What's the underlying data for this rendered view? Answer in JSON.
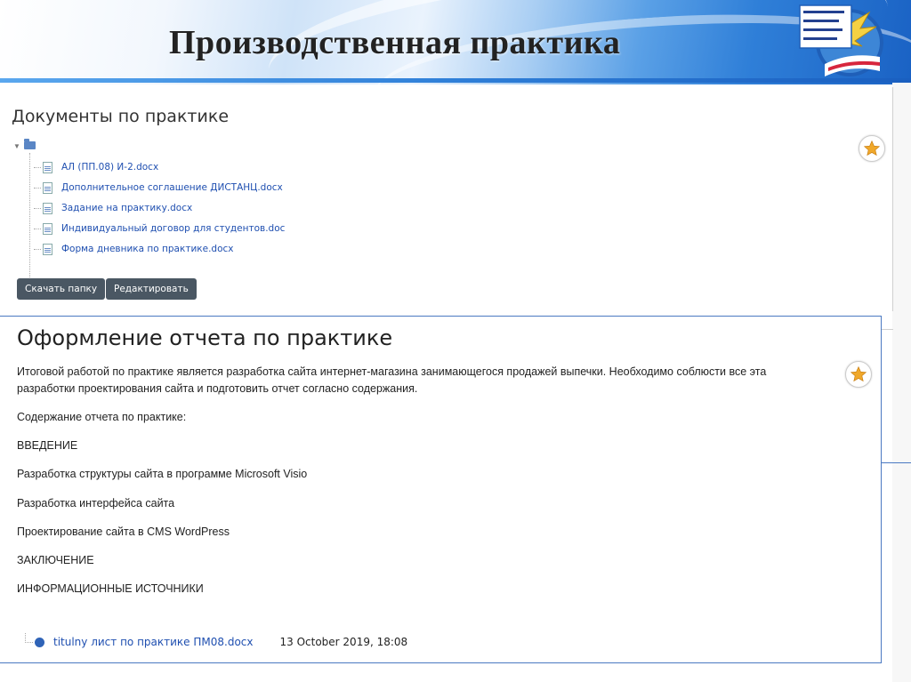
{
  "slide": {
    "title": "Производственная практика"
  },
  "documents": {
    "heading": "Документы по практике",
    "files": [
      "АЛ (ПП.08) И-2.docx",
      "Дополнительное соглашение ДИСТАНЦ.docx",
      "Задание на практику.docx",
      "Индивидуальный договор для студентов.doc",
      "Форма дневника по практике.docx"
    ],
    "download_label": "Скачать папку",
    "edit_label": "Редактировать"
  },
  "report": {
    "heading": "Оформление отчета по практике",
    "intro_line1": "Итоговой работой по практике является разработка сайта интернет-магазина занимающегося продажей выпечки. Необходимо соблюсти все эта",
    "intro_line2": "разработки проектирования сайта и подготовить отчет согласно содержания.",
    "contents_label": "Содержание отчета по практике:",
    "items": [
      "ВВЕДЕНИЕ",
      "Разработка структуры сайта в программе Microsoft Visio",
      "Разработка интерфейса сайта",
      "Проектирование сайта в CMS WordPress",
      "ЗАКЛЮЧЕНИЕ",
      "ИНФОРМАЦИОННЫЕ ИСТОЧНИКИ"
    ],
    "file_name": "titulny лист по практике ПМ08.docx",
    "file_date": "13 October 2019, 18:08"
  },
  "colors": {
    "link": "#1f4fb0",
    "button": "#4a5763",
    "star": "#f0a82a",
    "frame": "#4a79c2"
  },
  "icons": [
    "folder-icon",
    "document-icon",
    "star-icon",
    "logo-emblem"
  ]
}
